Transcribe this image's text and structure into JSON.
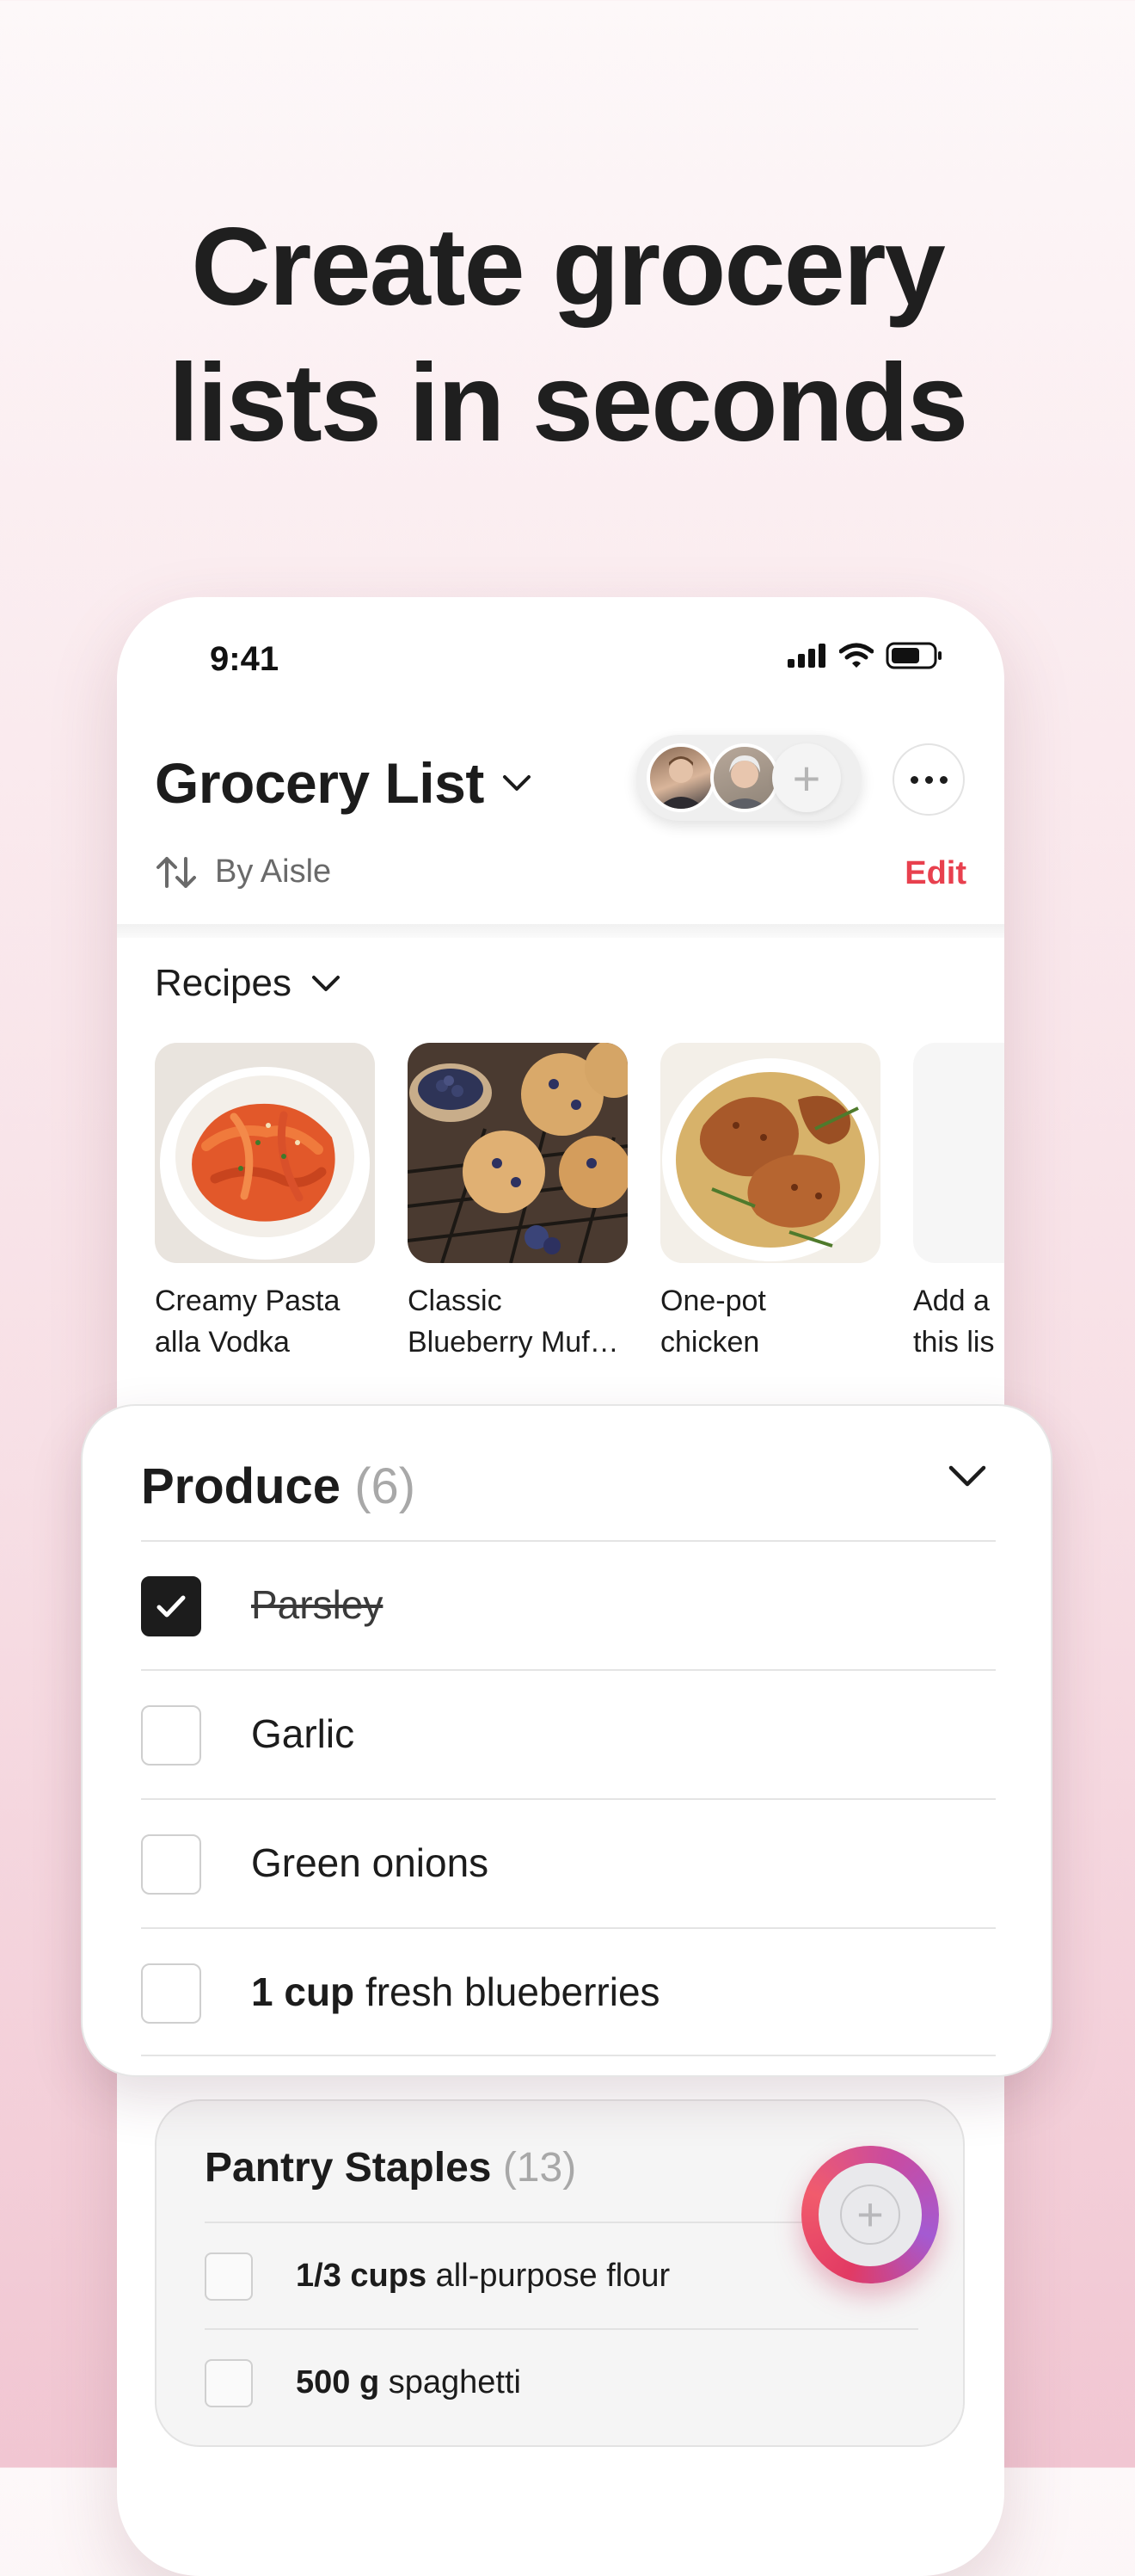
{
  "headline": {
    "line1": "Create grocery",
    "line2": "lists in seconds"
  },
  "status_bar": {
    "time": "9:41"
  },
  "header": {
    "title": "Grocery List",
    "add_collaborator_symbol": "+",
    "sort_label": "By Aisle",
    "edit_label": "Edit"
  },
  "recipes": {
    "label": "Recipes",
    "items": [
      {
        "line1": "Creamy Pasta",
        "line2": "alla Vodka",
        "image": "pasta-photo"
      },
      {
        "line1": "Classic",
        "line2": "Blueberry Muf…",
        "image": "muffins-photo"
      },
      {
        "line1": "One-pot",
        "line2": "chicken",
        "image": "chicken-photo"
      },
      {
        "line1": "Add a",
        "line2": "this lis"
      }
    ]
  },
  "produce": {
    "title": "Produce",
    "count": "(6)",
    "items": [
      {
        "qty": "",
        "text": "Parsley",
        "checked": true
      },
      {
        "qty": "",
        "text": "Garlic",
        "checked": false
      },
      {
        "qty": "",
        "text": "Green onions",
        "checked": false
      },
      {
        "qty": "1 cup",
        "text": "fresh blueberries",
        "checked": false
      }
    ]
  },
  "pantry": {
    "title": "Pantry Staples",
    "count": "(13)",
    "items": [
      {
        "qty": "1/3 cups",
        "text": "all-purpose flour"
      },
      {
        "qty": "500 g",
        "text": "spaghetti"
      }
    ]
  },
  "fab": {
    "symbol": "+"
  },
  "colors": {
    "accent": "#e8404e",
    "check": "#1c1c1c",
    "count": "#a8a8a8"
  }
}
